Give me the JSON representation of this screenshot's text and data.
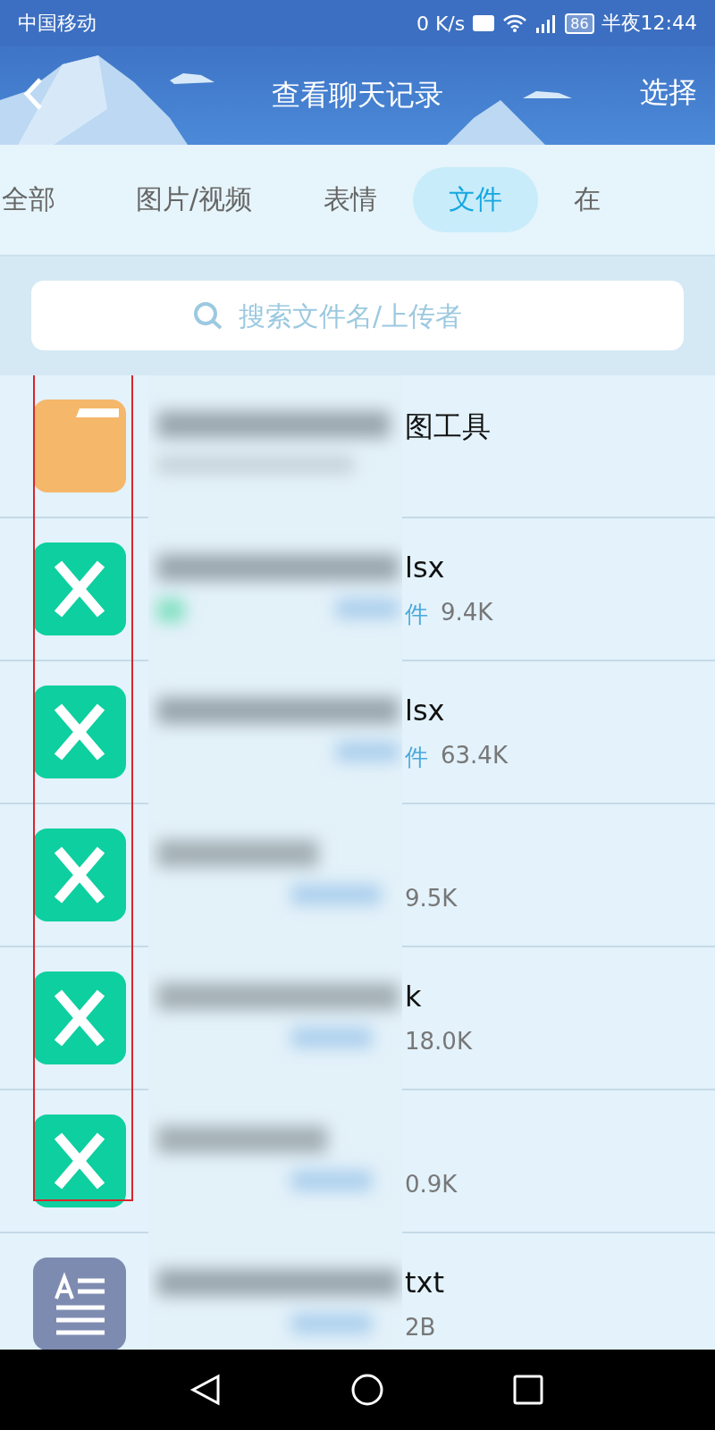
{
  "status_bar": {
    "carrier": "中国移动",
    "speed": "0 K/s",
    "battery": "86",
    "time": "半夜12:44"
  },
  "header": {
    "title": "查看聊天记录",
    "action": "选择"
  },
  "tabs": [
    {
      "label": "全部",
      "selected": false
    },
    {
      "label": "图片/视频",
      "selected": false
    },
    {
      "label": "表情",
      "selected": false
    },
    {
      "label": "文件",
      "selected": true
    },
    {
      "label": "在",
      "selected": false
    }
  ],
  "search": {
    "placeholder": "搜索文件名/上传者"
  },
  "files": [
    {
      "kind": "folder",
      "name": "图工具"
    },
    {
      "kind": "excel",
      "name": "lsx",
      "source": "件",
      "size": "9.4K"
    },
    {
      "kind": "excel",
      "name": "lsx",
      "source": "件",
      "size": "63.4K"
    },
    {
      "kind": "excel",
      "size": "9.5K"
    },
    {
      "kind": "excel",
      "name": "k",
      "size": "18.0K"
    },
    {
      "kind": "excel",
      "size": "0.9K"
    },
    {
      "kind": "text",
      "name": "txt",
      "size": "2B"
    }
  ]
}
